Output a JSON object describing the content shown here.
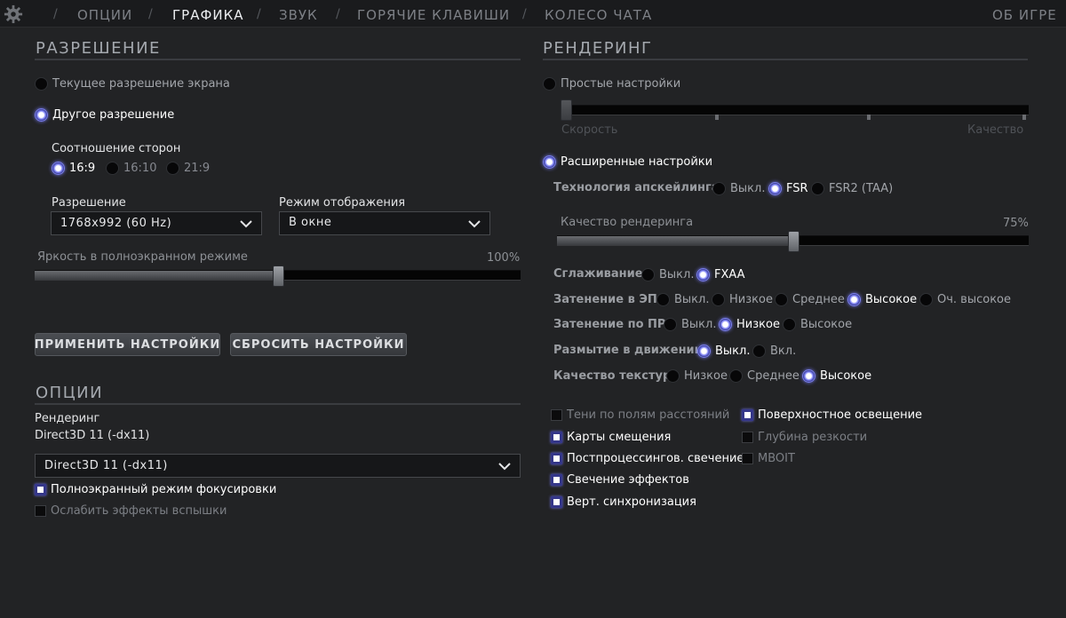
{
  "nav": {
    "tabs": [
      "ОПЦИИ",
      "ГРАФИКА",
      "ЗВУК",
      "ГОРЯЧИЕ КЛАВИШИ",
      "КОЛЕСО ЧАТА"
    ],
    "active_tab": "ГРАФИКА",
    "about": "ОБ ИГРЕ",
    "separator": "/"
  },
  "resolution": {
    "title": "РАЗРЕШЕНИЕ",
    "current_label": "Текущее разрешение экрана",
    "current_selected": false,
    "other_label": "Другое разрешение",
    "other_selected": true,
    "aspect_label": "Соотношение сторон",
    "aspect_options": [
      {
        "label": "16:9",
        "selected": true
      },
      {
        "label": "16:10",
        "selected": false
      },
      {
        "label": "21:9",
        "selected": false
      }
    ],
    "resolution_label": "Разрешение",
    "resolution_value": "1768x992 (60 Hz)",
    "display_mode_label": "Режим отображения",
    "display_mode_value": "В окне",
    "brightness_label": "Яркость в полноэкранном режиме",
    "brightness_value_text": "100%",
    "brightness_fraction": 0.5
  },
  "buttons": {
    "apply": "ПРИМЕНИТЬ НАСТРОЙКИ",
    "reset": "СБРОСИТЬ НАСТРОЙКИ"
  },
  "options": {
    "title": "ОПЦИИ",
    "rendering_label": "Рендеринг",
    "rendering_current": "Direct3D 11 (-dx11)",
    "rendering_value": "Direct3D 11 (-dx11)",
    "fullscreen_focus": {
      "label": "Полноэкранный режим фокусировки",
      "checked": true
    },
    "reduce_flash": {
      "label": "Ослабить эффекты вспышки",
      "checked": false
    }
  },
  "rendering": {
    "title": "РЕНДЕРИНГ",
    "simple_label": "Простые настройки",
    "simple_selected": false,
    "speed_label": "Скорость",
    "quality_label": "Качество",
    "simple_slider_fraction": 0.0,
    "advanced_label": "Расширенные настройки",
    "advanced_selected": true,
    "upscaling_label": "Технология апскейлинга",
    "upscaling_options": [
      {
        "label": "Выкл.",
        "selected": false
      },
      {
        "label": "FSR",
        "selected": true
      },
      {
        "label": "FSR2 (TAA)",
        "selected": false
      }
    ],
    "render_quality_label": "Качество рендеринга",
    "render_quality_text": "75%",
    "render_quality_fraction": 0.5,
    "rows": [
      {
        "label": "Сглаживание",
        "options": [
          {
            "label": "Выкл.",
            "selected": false
          },
          {
            "label": "FXAA",
            "selected": true
          }
        ]
      },
      {
        "label": "Затенение в ЭП",
        "options": [
          {
            "label": "Выкл.",
            "selected": false
          },
          {
            "label": "Низкое",
            "selected": false
          },
          {
            "label": "Среднее",
            "selected": false
          },
          {
            "label": "Высокое",
            "selected": true
          },
          {
            "label": "Оч. высокое",
            "selected": false
          }
        ]
      },
      {
        "label": "Затенение по ПР",
        "options": [
          {
            "label": "Выкл.",
            "selected": false
          },
          {
            "label": "Низкое",
            "selected": true
          },
          {
            "label": "Высокое",
            "selected": false
          }
        ]
      },
      {
        "label": "Размытие в движении",
        "options": [
          {
            "label": "Выкл.",
            "selected": true
          },
          {
            "label": "Вкл.",
            "selected": false
          }
        ]
      },
      {
        "label": "Качество текстур",
        "options": [
          {
            "label": "Низкое",
            "selected": false
          },
          {
            "label": "Среднее",
            "selected": false
          },
          {
            "label": "Высокое",
            "selected": true
          }
        ]
      }
    ],
    "checks_left": [
      {
        "label": "Тени по полям расстояний",
        "checked": false
      },
      {
        "label": "Карты смещения",
        "checked": true
      },
      {
        "label": "Постпроцессингов. свечение",
        "checked": true
      },
      {
        "label": "Свечение эффектов",
        "checked": true
      },
      {
        "label": "Верт. синхронизация",
        "checked": true
      }
    ],
    "checks_right": [
      {
        "label": "Поверхностное освещение",
        "checked": true
      },
      {
        "label": "Глубина резкости",
        "checked": false
      },
      {
        "label": "MBOIT",
        "checked": false
      }
    ]
  }
}
